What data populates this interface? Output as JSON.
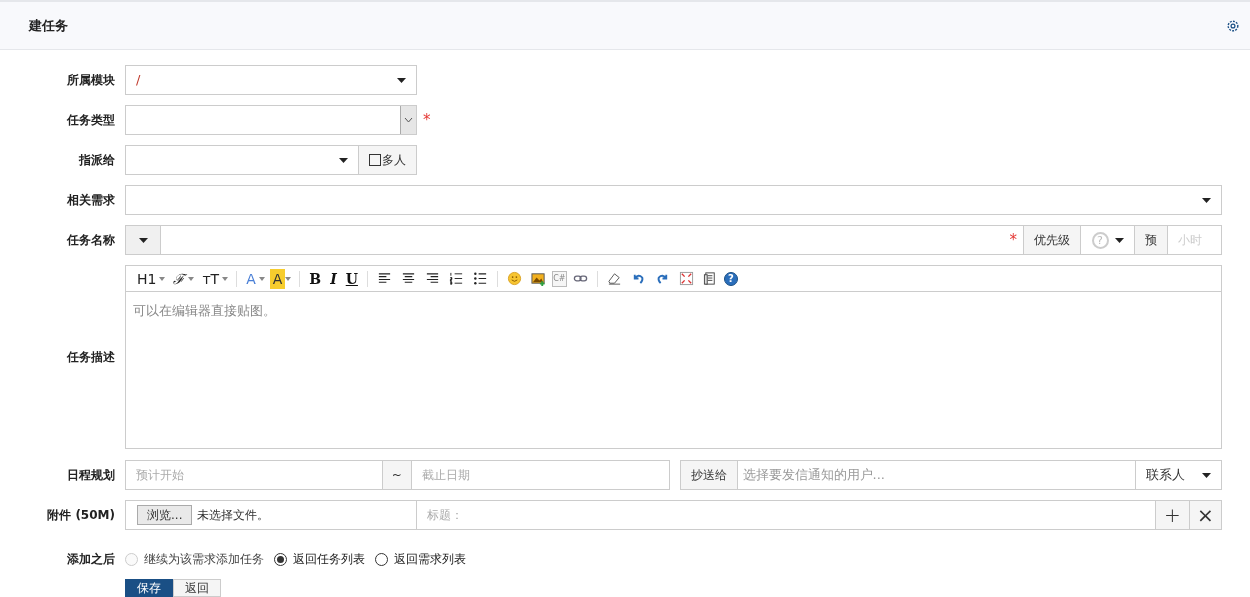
{
  "header": {
    "title": "建任务"
  },
  "module": {
    "label": "所属模块",
    "value": "/"
  },
  "task_type": {
    "label": "任务类型",
    "required_mark": "*"
  },
  "assign": {
    "label": "指派给",
    "multi_label": "多人",
    "multi_checked": false
  },
  "story": {
    "label": "相关需求"
  },
  "name": {
    "label": "任务名称",
    "required_mark": "*",
    "priority_label": "优先级",
    "priority_value": "?",
    "estimate_label": "预",
    "estimate_placeholder": "小时"
  },
  "description": {
    "label": "任务描述",
    "placeholder": "可以在编辑器直接贴图。",
    "toolbar": [
      {
        "kind": "heading",
        "label": "H1"
      },
      {
        "kind": "font",
        "label": "ℱ"
      },
      {
        "kind": "size",
        "label": "ᴛT"
      },
      {
        "kind": "sep"
      },
      {
        "kind": "forecolor",
        "label": "A"
      },
      {
        "kind": "backcolor",
        "label": "A"
      },
      {
        "kind": "sep"
      },
      {
        "kind": "bold",
        "label": "B"
      },
      {
        "kind": "italic",
        "label": "I"
      },
      {
        "kind": "underline",
        "label": "U"
      },
      {
        "kind": "sep"
      },
      {
        "kind": "align-left"
      },
      {
        "kind": "align-center"
      },
      {
        "kind": "align-right"
      },
      {
        "kind": "ordered-list"
      },
      {
        "kind": "bullet-list"
      },
      {
        "kind": "sep"
      },
      {
        "kind": "emoji"
      },
      {
        "kind": "image"
      },
      {
        "kind": "code",
        "label": "C#"
      },
      {
        "kind": "link"
      },
      {
        "kind": "sep"
      },
      {
        "kind": "eraser"
      },
      {
        "kind": "undo"
      },
      {
        "kind": "redo"
      },
      {
        "kind": "fullscreen"
      },
      {
        "kind": "paste"
      },
      {
        "kind": "help",
        "label": "?"
      }
    ]
  },
  "schedule": {
    "label": "日程规划",
    "start_placeholder": "预计开始",
    "separator": "~",
    "end_placeholder": "截止日期",
    "cc_label": "抄送给",
    "cc_placeholder": "选择要发信通知的用户...",
    "contacts": "联系人"
  },
  "attachment": {
    "label": "附件 (50M)",
    "browse": "浏览...",
    "no_file": "未选择文件。",
    "title_placeholder": "标题：",
    "add": "+",
    "remove": "×"
  },
  "after": {
    "label": "添加之后",
    "options": [
      {
        "label": "继续为该需求添加任务",
        "selected": false,
        "disabled": true
      },
      {
        "label": "返回任务列表",
        "selected": true,
        "disabled": false
      },
      {
        "label": "返回需求列表",
        "selected": false,
        "disabled": false
      }
    ]
  },
  "buttons": [
    {
      "label": "保存",
      "kind": "primary"
    },
    {
      "label": "返回",
      "kind": "default"
    }
  ]
}
